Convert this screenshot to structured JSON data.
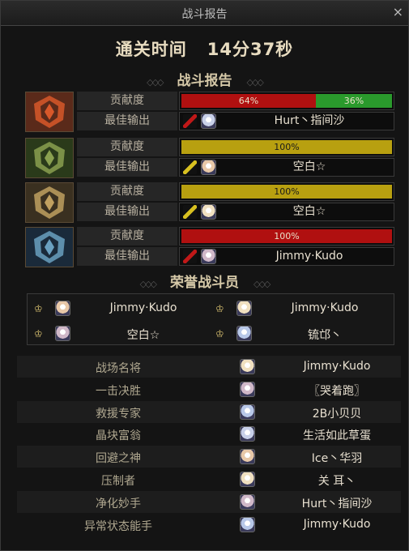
{
  "window": {
    "title": "战斗报告",
    "close_icon": "×"
  },
  "clear_time": "通关时间   14分37秒",
  "battle_report_header": "战斗报告",
  "honor_header": "荣誉战斗员",
  "ornament": "◇◇◇",
  "row_labels": {
    "contribution": "贡献度",
    "best_output": "最佳输出"
  },
  "teams": [
    {
      "emblem": "fire-emblem-icon",
      "bars": [
        {
          "label": "64%",
          "value": 0.64,
          "color": "#b01010"
        },
        {
          "label": "36%",
          "value": 0.36,
          "color": "#2a9a2c"
        }
      ],
      "weapon_color": "#c01818",
      "best_output": "Hurt丶指间沙"
    },
    {
      "emblem": "green-emblem-icon",
      "bars": [
        {
          "label": "100%",
          "value": 1.0,
          "color": "#b8a010"
        }
      ],
      "weapon_color": "#d8c020",
      "best_output": "空白☆"
    },
    {
      "emblem": "gold-emblem-icon",
      "bars": [
        {
          "label": "100%",
          "value": 1.0,
          "color": "#b8a010"
        }
      ],
      "weapon_color": "#d8c020",
      "best_output": "空白☆"
    },
    {
      "emblem": "blue-emblem-icon",
      "bars": [
        {
          "label": "100%",
          "value": 1.0,
          "color": "#b01010"
        }
      ],
      "weapon_color": "#c01818",
      "best_output": "Jimmy·Kudo"
    }
  ],
  "honor_members": [
    "Jimmy·Kudo",
    "Jimmy·Kudo",
    "空白☆",
    "锍邙丶"
  ],
  "awards": [
    {
      "title": "战场名将",
      "player": "Jimmy·Kudo"
    },
    {
      "title": "一击决胜",
      "player": "〖哭着跑〗"
    },
    {
      "title": "救援专家",
      "player": "2B小贝贝"
    },
    {
      "title": "晶块富翁",
      "player": "生活如此草蛋"
    },
    {
      "title": "回避之神",
      "player": "Ice丶华羽"
    },
    {
      "title": "压制者",
      "player": "关 耳丶"
    },
    {
      "title": "净化妙手",
      "player": "Hurt丶指间沙"
    },
    {
      "title": "异常状态能手",
      "player": "Jimmy·Kudo"
    }
  ]
}
